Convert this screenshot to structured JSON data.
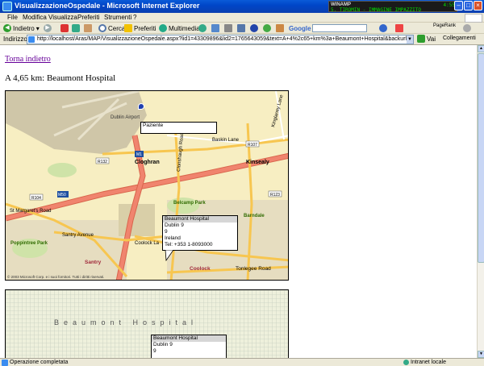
{
  "window": {
    "title": "VisualizzazioneOspedale - Microsoft Internet Explorer"
  },
  "winamp": {
    "label": "WINAMP",
    "track": "5. TIROMIN - IMMAGINE IMPAZZITO",
    "time": "4:55"
  },
  "menu": {
    "items": [
      "File",
      "Modifica",
      "Visualizza",
      "Preferiti",
      "Strumenti",
      "?"
    ]
  },
  "toolbar": {
    "back_label": "Indietro",
    "search_label": "Cerca",
    "favorites_label": "Preferiti",
    "multimedia_label": "Multimedia",
    "google_label": "Google",
    "pagerank_label": "PageRank"
  },
  "address": {
    "label": "Indirizzo",
    "url": "http://localhost/Aras/MAP/VisualizzazioneOspedale.aspx?lid1=43309896&lid2=1765643059&text=A+4%2c65+km%3a+Beaumont+Hospital&backurl=%2fAras",
    "go_label": "Vai",
    "links_label": "Collegamenti"
  },
  "page": {
    "back_link": "Torna indietro",
    "distance_text": "A 4,65 km: Beaumont Hospital"
  },
  "map1": {
    "patient_label": "Paziente",
    "hospital_popup": [
      "Beaumont Hospital",
      "Dublin 9",
      "9",
      "Ireland",
      "Tel: +353 1-8093000"
    ],
    "copyright": "© 2003 Microsoft Corp. e i suoi fornitori. Tutti i diritti riservati.",
    "labels": {
      "dublin_airport": "Dublin Airport",
      "cloghran": "Cloghran",
      "kinsealy": "Kinsealy",
      "baskin": "Baskin Lane",
      "kinglaney": "Kinglaney Lane",
      "clonshaugh_rd": "Clonshaugh Road",
      "st_margarets": "St Margaret's Road",
      "santry_ave": "Santry Avenue",
      "coolock_la": "Coolock La",
      "tonlegee": "Tonlegee Road",
      "belcamp": "Belcamp Park",
      "barndale": "Barndale",
      "poppintree": "Poppintree Park",
      "santry": "Santry",
      "coolock": "Coolock",
      "r132": "R132",
      "r107": "R107",
      "r123": "R123",
      "r104": "R104",
      "m1": "M1",
      "m50": "M50"
    },
    "colors": {
      "motorway": "#f0846e",
      "road": "#f7c650",
      "land": "#f7eec2",
      "airport": "#cfc6a8",
      "urban": "#e6ddc0"
    }
  },
  "map2": {
    "label": "Beaumont Hospital",
    "hospital_popup": [
      "Beaumont Hospital",
      "Dublin 9",
      "9"
    ]
  },
  "status": {
    "text": "Operazione completata",
    "zone": "Intranet locale"
  }
}
